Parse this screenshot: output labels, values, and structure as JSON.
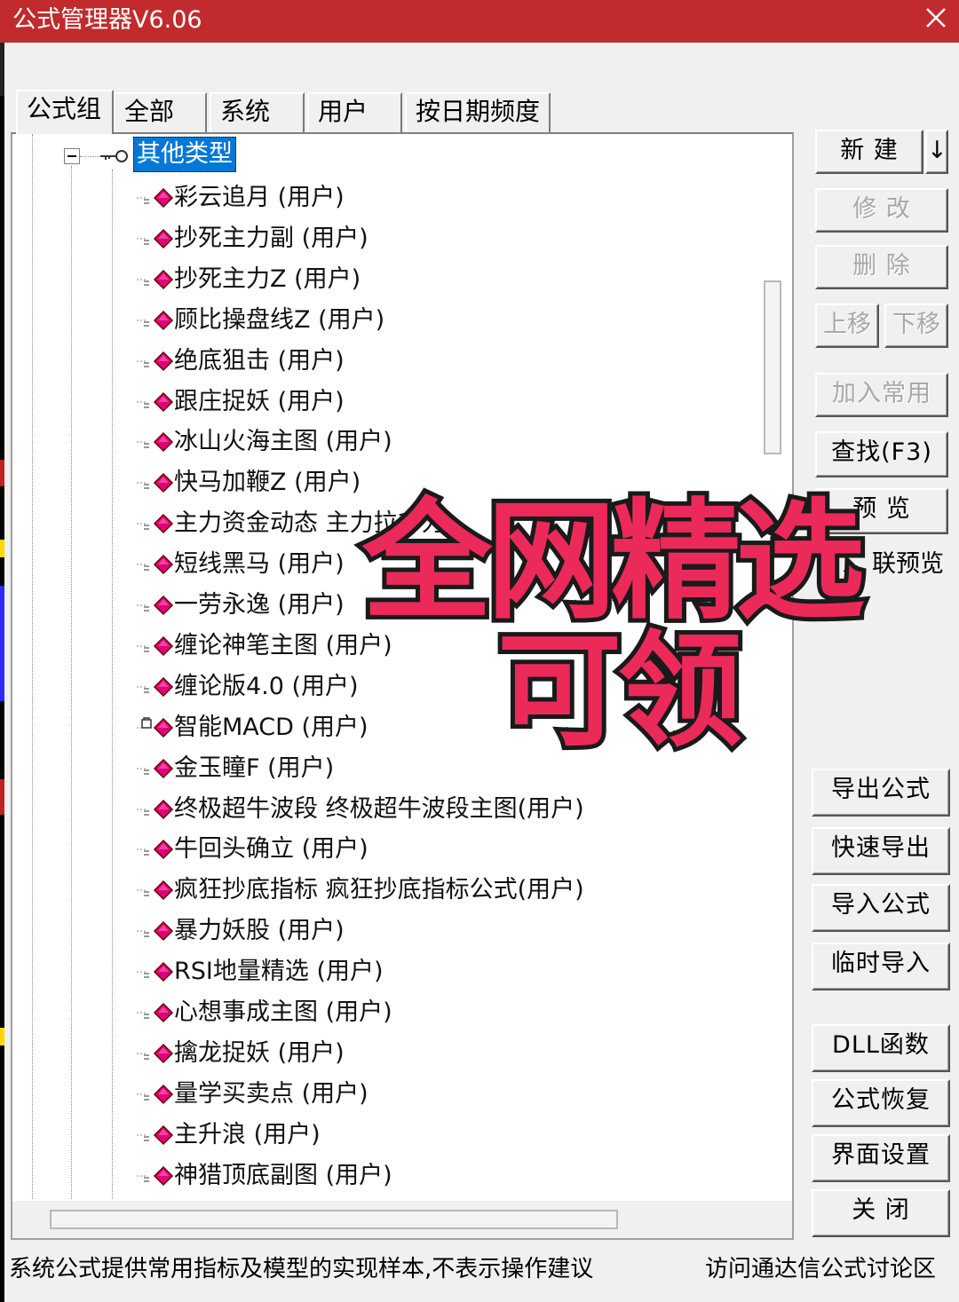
{
  "window": {
    "title": "公式管理器V6.06"
  },
  "tabs": [
    {
      "label": "公式组",
      "active": true
    },
    {
      "label": "全部",
      "active": false
    },
    {
      "label": "系统",
      "active": false
    },
    {
      "label": "用户",
      "active": false
    },
    {
      "label": "按日期频度",
      "active": false
    }
  ],
  "tree": {
    "root_label": "其他类型",
    "items": [
      {
        "label": "彩云追月  (用户)"
      },
      {
        "label": "抄死主力副  (用户)"
      },
      {
        "label": "抄死主力Z  (用户)"
      },
      {
        "label": "顾比操盘线Z  (用户)"
      },
      {
        "label": "绝底狙击  (用户)"
      },
      {
        "label": "跟庄捉妖  (用户)"
      },
      {
        "label": "冰山火海主图  (用户)"
      },
      {
        "label": "快马加鞭Z  (用户)"
      },
      {
        "label": "主力资金动态  主力拉升力"
      },
      {
        "label": "短线黑马  (用户)"
      },
      {
        "label": "一劳永逸  (用户)"
      },
      {
        "label": "缠论神笔主图  (用户)"
      },
      {
        "label": "缠论版4.0  (用户)"
      },
      {
        "label": "智能MACD  (用户)",
        "locked": true
      },
      {
        "label": "金玉瞳F  (用户)"
      },
      {
        "label": "终极超牛波段  终极超牛波段主图(用户)"
      },
      {
        "label": "牛回头确立  (用户)"
      },
      {
        "label": "疯狂抄底指标  疯狂抄底指标公式(用户)"
      },
      {
        "label": "暴力妖股  (用户)"
      },
      {
        "label": "RSI地量精选  (用户)"
      },
      {
        "label": "心想事成主图  (用户)"
      },
      {
        "label": "擒龙捉妖  (用户)"
      },
      {
        "label": "量学买卖点  (用户)"
      },
      {
        "label": "主升浪  (用户)"
      },
      {
        "label": "神猎顶底副图  (用户)"
      }
    ]
  },
  "buttons": {
    "new": "新 建",
    "new_arrow": "↓",
    "modify": "修 改",
    "delete": "删 除",
    "move_up": "上移",
    "move_down": "下移",
    "add_common": "加入常用",
    "find": "查找(F3)",
    "preview": "预 览",
    "linked_preview": "联预览",
    "export_formula": "导出公式",
    "quick_export": "快速导出",
    "import_formula": "导入公式",
    "temp_import": "临时导入",
    "dll_function": "DLL函数",
    "restore_formula": "公式恢复",
    "ui_settings": "界面设置",
    "close": "关 闭"
  },
  "status": {
    "left": "系统公式提供常用指标及模型的实现样本,不表示操作建议",
    "right": "访问通达信公式讨论区"
  },
  "overlay": {
    "line1": "全网精选",
    "line2": "可领"
  },
  "colors": {
    "titlebar": "#c12b2e",
    "selection": "#0078d7",
    "overlay_fill": "#ec2a5a",
    "overlay_stroke": "#1a1a1a",
    "diamond": "#e0007a"
  }
}
